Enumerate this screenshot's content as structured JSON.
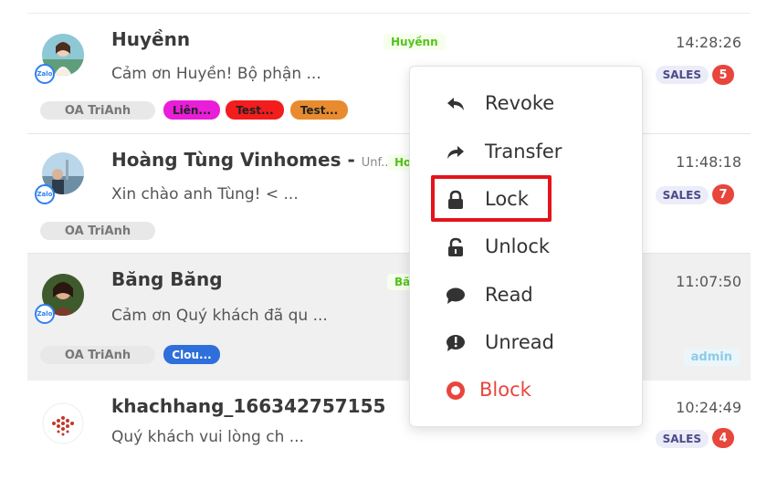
{
  "conversations": [
    {
      "name": "Huyềnn",
      "name_suffix": "",
      "preview": "Cảm ơn Huyền! Bộ phận ...",
      "time": "14:28:26",
      "tag": "Huyềnn",
      "oa": "OA TriAnh",
      "labels": [
        {
          "text": "Liên...",
          "color": "#e81ed8"
        },
        {
          "text": "Test...",
          "color": "#f31d1d"
        },
        {
          "text": "Test...",
          "color": "#e88b2e"
        }
      ],
      "sales": "SALES",
      "unread": "5"
    },
    {
      "name": "Hoàng Tùng Vinhomes - ",
      "name_suffix": "Unf...",
      "preview": "Xin chào anh Tùng! < ...",
      "time": "11:48:18",
      "tag": "Ho",
      "oa": "OA TriAnh",
      "labels": [],
      "sales": "SALES",
      "unread": "7"
    },
    {
      "name": "Băng Băng",
      "name_suffix": "",
      "preview": "Cảm ơn Quý khách đã qu ...",
      "time": "11:07:50",
      "tag": "Bă",
      "oa": "OA TriAnh",
      "labels": [
        {
          "text": "Clou...",
          "color": "#2f6fdb"
        }
      ],
      "assignee": "admin"
    },
    {
      "name": "khachhang_166342757155",
      "name_suffix": "",
      "preview": "Quý khách vui lòng ch ...",
      "time": "10:24:49",
      "sales": "SALES",
      "unread": "4"
    }
  ],
  "zalo_badge": "Zalo",
  "menu": {
    "items": [
      {
        "label": "Revoke",
        "icon": "reply-icon"
      },
      {
        "label": "Transfer",
        "icon": "forward-icon"
      },
      {
        "label": "Lock",
        "icon": "lock-icon"
      },
      {
        "label": "Unlock",
        "icon": "unlock-icon"
      },
      {
        "label": "Read",
        "icon": "chat-bubble-icon"
      },
      {
        "label": "Unread",
        "icon": "exclamation-bubble-icon"
      },
      {
        "label": "Block",
        "icon": "block-icon",
        "color": "#e8453c"
      }
    ],
    "highlighted": "Lock",
    "highlight_color": "#e3141b"
  }
}
